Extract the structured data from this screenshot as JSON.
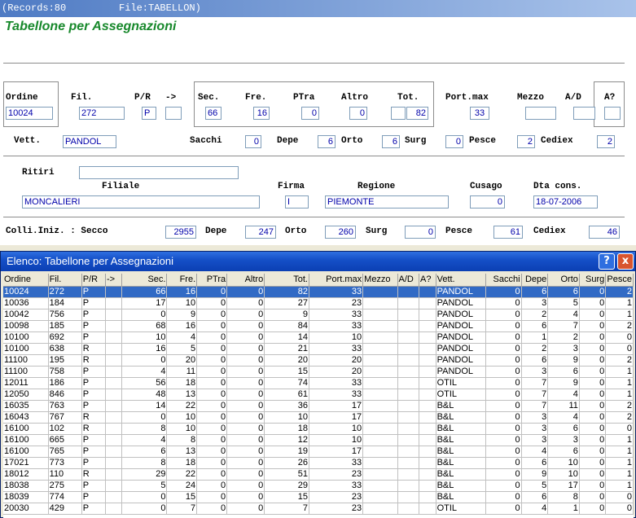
{
  "titlebar": {
    "records": "(Records:80",
    "file": "File:TABELLON)"
  },
  "form": {
    "title": "Tabellone per Assegnazioni",
    "labels": {
      "ordine": "Ordine",
      "fil": "Fil.",
      "pr": "P/R",
      "arrow": "->",
      "sec": "Sec.",
      "fre": "Fre.",
      "ptra": "PTra",
      "altro": "Altro",
      "tot": "Tot.",
      "portmax": "Port.max",
      "mezzo": "Mezzo",
      "ad": "A/D",
      "aq": "A?",
      "vett": "Vett.",
      "sacchi": "Sacchi",
      "depe": "Depe",
      "orto": "Orto",
      "surg": "Surg",
      "pesce": "Pesce",
      "cediex": "Cediex",
      "ritiri": "Ritiri",
      "filiale": "Filiale",
      "firma": "Firma",
      "regione": "Regione",
      "cusago": "Cusago",
      "dtacons": "Dta cons.",
      "colli": "Colli.Iniz. : Secco",
      "c_depe": "Depe",
      "c_orto": "Orto",
      "c_surg": "Surg",
      "c_pesce": "Pesce",
      "c_cediex": "Cediex"
    },
    "values": {
      "ordine": "10024",
      "fil": "272",
      "pr": "P",
      "arrow": "",
      "sec": "66",
      "fre": "16",
      "ptra": "0",
      "altro": "0",
      "tot_a": "",
      "tot": "82",
      "portmax": "33",
      "mezzo": "",
      "ad": "",
      "aq": "",
      "vett": "PANDOL",
      "sacchi": "0",
      "depe": "6",
      "orto": "6",
      "surg": "0",
      "pesce": "2",
      "cediex": "2",
      "ritiri": "",
      "filiale": "MONCALIERI",
      "firma": "I",
      "regione": "PIEMONTE",
      "cusago": "0",
      "dtacons": "18-07-2006",
      "c_secco": "2955",
      "c_depe": "247",
      "c_orto": "260",
      "c_surg": "0",
      "c_pesce": "61",
      "c_cediex": "46"
    }
  },
  "dialog": {
    "title": "Elenco: Tabellone per Assegnazioni",
    "help": "?",
    "close": "x",
    "columns": [
      "Ordine",
      "Fil.",
      "P/R",
      "->",
      "Sec.",
      "Fre.",
      "PTra",
      "Altro",
      "Tot.",
      "Port.max",
      "Mezzo",
      "A/D",
      "A?",
      "Vett.",
      "Sacchi",
      "Depe",
      "Orto",
      "Surg",
      "Pesce"
    ],
    "rows": [
      [
        "10024",
        "272",
        "P",
        "",
        "66",
        "16",
        "0",
        "0",
        "82",
        "33",
        "",
        "",
        "",
        "PANDOL",
        "0",
        "6",
        "6",
        "0",
        "2"
      ],
      [
        "10036",
        "184",
        "P",
        "",
        "17",
        "10",
        "0",
        "0",
        "27",
        "23",
        "",
        "",
        "",
        "PANDOL",
        "0",
        "3",
        "5",
        "0",
        "1"
      ],
      [
        "10042",
        "756",
        "P",
        "",
        "0",
        "9",
        "0",
        "0",
        "9",
        "33",
        "",
        "",
        "",
        "PANDOL",
        "0",
        "2",
        "4",
        "0",
        "1"
      ],
      [
        "10098",
        "185",
        "P",
        "",
        "68",
        "16",
        "0",
        "0",
        "84",
        "33",
        "",
        "",
        "",
        "PANDOL",
        "0",
        "6",
        "7",
        "0",
        "2"
      ],
      [
        "10100",
        "692",
        "P",
        "",
        "10",
        "4",
        "0",
        "0",
        "14",
        "10",
        "",
        "",
        "",
        "PANDOL",
        "0",
        "1",
        "2",
        "0",
        "0"
      ],
      [
        "10100",
        "638",
        "R",
        "",
        "16",
        "5",
        "0",
        "0",
        "21",
        "33",
        "",
        "",
        "",
        "PANDOL",
        "0",
        "2",
        "3",
        "0",
        "0"
      ],
      [
        "11100",
        "195",
        "R",
        "",
        "0",
        "20",
        "0",
        "0",
        "20",
        "20",
        "",
        "",
        "",
        "PANDOL",
        "0",
        "6",
        "9",
        "0",
        "2"
      ],
      [
        "11100",
        "758",
        "P",
        "",
        "4",
        "11",
        "0",
        "0",
        "15",
        "20",
        "",
        "",
        "",
        "PANDOL",
        "0",
        "3",
        "6",
        "0",
        "1"
      ],
      [
        "12011",
        "186",
        "P",
        "",
        "56",
        "18",
        "0",
        "0",
        "74",
        "33",
        "",
        "",
        "",
        "OTIL",
        "0",
        "7",
        "9",
        "0",
        "1"
      ],
      [
        "12050",
        "846",
        "P",
        "",
        "48",
        "13",
        "0",
        "0",
        "61",
        "33",
        "",
        "",
        "",
        "OTIL",
        "0",
        "7",
        "4",
        "0",
        "1"
      ],
      [
        "16035",
        "763",
        "P",
        "",
        "14",
        "22",
        "0",
        "0",
        "36",
        "17",
        "",
        "",
        "",
        "B&L",
        "0",
        "7",
        "11",
        "0",
        "2"
      ],
      [
        "16043",
        "767",
        "R",
        "",
        "0",
        "10",
        "0",
        "0",
        "10",
        "17",
        "",
        "",
        "",
        "B&L",
        "0",
        "3",
        "4",
        "0",
        "2"
      ],
      [
        "16100",
        "102",
        "R",
        "",
        "8",
        "10",
        "0",
        "0",
        "18",
        "10",
        "",
        "",
        "",
        "B&L",
        "0",
        "3",
        "6",
        "0",
        "0"
      ],
      [
        "16100",
        "665",
        "P",
        "",
        "4",
        "8",
        "0",
        "0",
        "12",
        "10",
        "",
        "",
        "",
        "B&L",
        "0",
        "3",
        "3",
        "0",
        "1"
      ],
      [
        "16100",
        "765",
        "P",
        "",
        "6",
        "13",
        "0",
        "0",
        "19",
        "17",
        "",
        "",
        "",
        "B&L",
        "0",
        "4",
        "6",
        "0",
        "1"
      ],
      [
        "17021",
        "773",
        "P",
        "",
        "8",
        "18",
        "0",
        "0",
        "26",
        "33",
        "",
        "",
        "",
        "B&L",
        "0",
        "6",
        "10",
        "0",
        "1"
      ],
      [
        "18012",
        "110",
        "R",
        "",
        "29",
        "22",
        "0",
        "0",
        "51",
        "23",
        "",
        "",
        "",
        "B&L",
        "0",
        "9",
        "10",
        "0",
        "1"
      ],
      [
        "18038",
        "275",
        "P",
        "",
        "5",
        "24",
        "0",
        "0",
        "29",
        "33",
        "",
        "",
        "",
        "B&L",
        "0",
        "5",
        "17",
        "0",
        "1"
      ],
      [
        "18039",
        "774",
        "P",
        "",
        "0",
        "15",
        "0",
        "0",
        "15",
        "23",
        "",
        "",
        "",
        "B&L",
        "0",
        "6",
        "8",
        "0",
        "0"
      ],
      [
        "20030",
        "429",
        "P",
        "",
        "0",
        "7",
        "0",
        "0",
        "7",
        "23",
        "",
        "",
        "",
        "OTIL",
        "0",
        "4",
        "1",
        "0",
        "0"
      ]
    ]
  }
}
